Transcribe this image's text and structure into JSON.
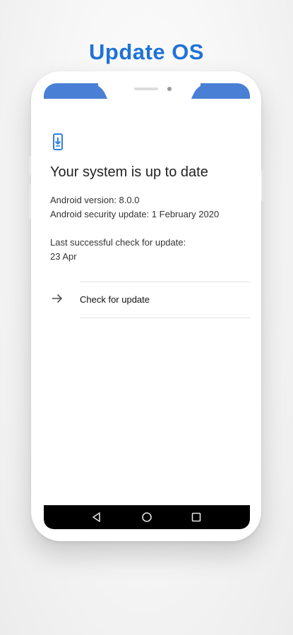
{
  "promo": {
    "title": "Update OS"
  },
  "status": {
    "heading": "Your system is up to date",
    "android_version": "Android version: 8.0.0",
    "security_update": "Android security update: 1 February 2020",
    "last_check_label": "Last successful check for update:",
    "last_check_date": "23 Apr"
  },
  "actions": {
    "check_label": "Check for update"
  },
  "icons": {
    "update": "system-update-icon",
    "arrow": "arrow-right-icon",
    "back": "nav-back-icon",
    "home": "nav-home-icon",
    "recents": "nav-recents-icon"
  },
  "colors": {
    "accent": "#1f73d6",
    "status_bar": "#4a7fd6",
    "icon_blue": "#2f7fe0"
  }
}
